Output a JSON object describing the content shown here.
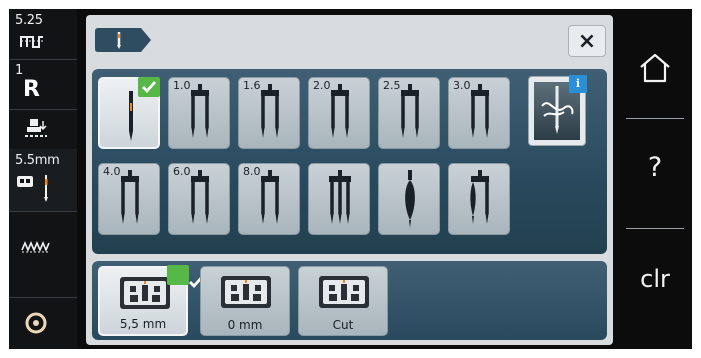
{
  "left_sidebar": {
    "stitch_width": "5.25",
    "presser_foot_number": "1",
    "foot_indicator": "R",
    "needle_plate": "5.5mm"
  },
  "header": {
    "close_label": "×"
  },
  "needles": [
    {
      "size": "",
      "selected": true,
      "type": "single"
    },
    {
      "size": "1.0",
      "type": "twin"
    },
    {
      "size": "1.6",
      "type": "twin"
    },
    {
      "size": "2.0",
      "type": "twin"
    },
    {
      "size": "2.5",
      "type": "twin"
    },
    {
      "size": "3.0",
      "type": "twin"
    },
    {
      "size": "4.0",
      "type": "twin"
    },
    {
      "size": "6.0",
      "type": "twin"
    },
    {
      "size": "8.0",
      "type": "twin"
    },
    {
      "size": "",
      "type": "triple"
    },
    {
      "size": "",
      "type": "wing"
    },
    {
      "size": "",
      "type": "double-wing"
    }
  ],
  "info_badge": "i",
  "needle_plates": [
    {
      "label": "5,5 mm",
      "selected": true
    },
    {
      "label": "0 mm"
    },
    {
      "label": "Cut"
    }
  ],
  "right_bar": {
    "help_label": "?",
    "clear_label": "clr"
  },
  "colors": {
    "accent_green": "#57b847",
    "info_blue": "#2a8fd6",
    "panel_blue": "#294a5e"
  }
}
